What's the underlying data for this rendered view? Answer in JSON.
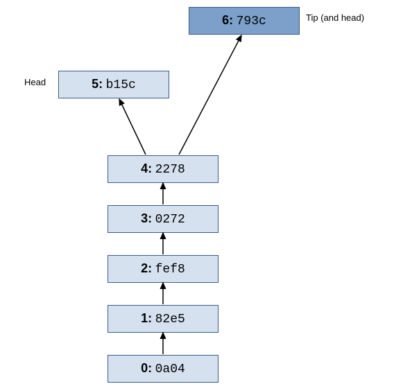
{
  "nodes": {
    "n6": {
      "num": "6:",
      "hash": "793c"
    },
    "n5": {
      "num": "5:",
      "hash": "b15c"
    },
    "n4": {
      "num": "4:",
      "hash": "2278"
    },
    "n3": {
      "num": "3:",
      "hash": "0272"
    },
    "n2": {
      "num": "2:",
      "hash": "fef8"
    },
    "n1": {
      "num": "1:",
      "hash": "82e5"
    },
    "n0": {
      "num": "0:",
      "hash": "0a04"
    }
  },
  "labels": {
    "head": "Head",
    "tip": "Tip (and head)"
  },
  "edges": [
    {
      "from": "n0",
      "to": "n1"
    },
    {
      "from": "n1",
      "to": "n2"
    },
    {
      "from": "n2",
      "to": "n3"
    },
    {
      "from": "n3",
      "to": "n4"
    },
    {
      "from": "n4",
      "to": "n5"
    },
    {
      "from": "n4",
      "to": "n6"
    }
  ],
  "styles": {
    "default_fill": "#d6e1f0",
    "tip_fill": "#7ca0c9",
    "border": "#3a5a8a"
  }
}
